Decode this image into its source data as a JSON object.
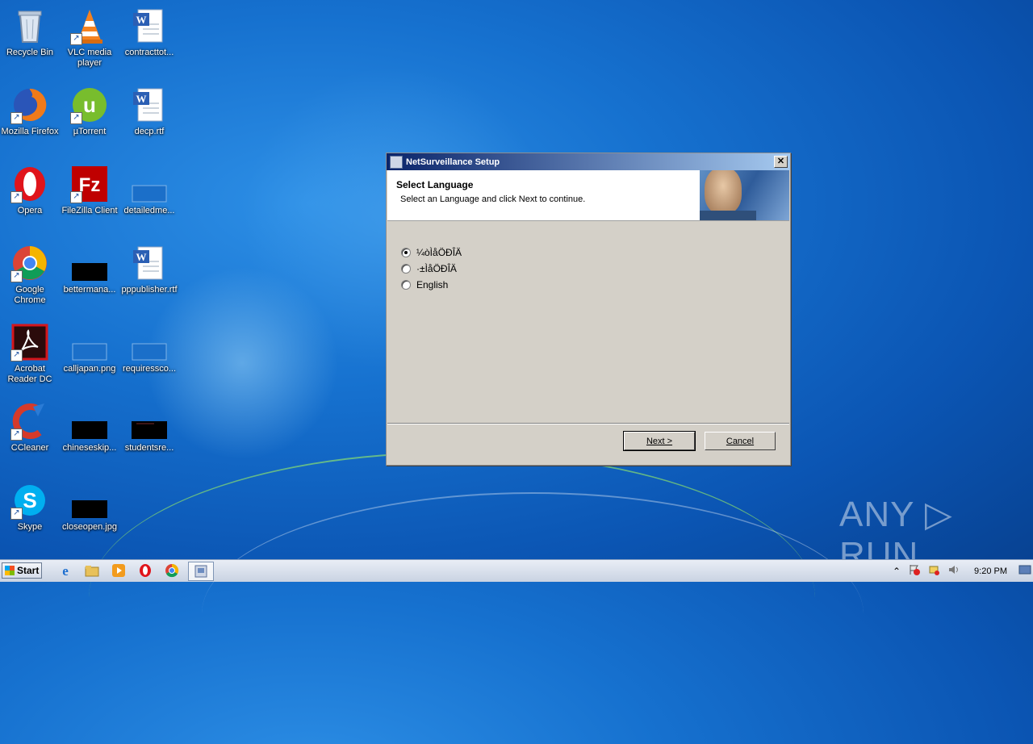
{
  "desktop": {
    "icons": [
      {
        "label": "Recycle Bin"
      },
      {
        "label": "VLC media player"
      },
      {
        "label": "contracttot..."
      },
      {
        "label": "Mozilla Firefox"
      },
      {
        "label": "µTorrent"
      },
      {
        "label": "decp.rtf"
      },
      {
        "label": "Opera"
      },
      {
        "label": "FileZilla Client"
      },
      {
        "label": "detailedme..."
      },
      {
        "label": "Google Chrome"
      },
      {
        "label": "bettermana..."
      },
      {
        "label": "pppublisher.rtf"
      },
      {
        "label": "Acrobat Reader DC"
      },
      {
        "label": "calljapan.png"
      },
      {
        "label": "requiressco..."
      },
      {
        "label": "CCleaner"
      },
      {
        "label": "chineseskip..."
      },
      {
        "label": "studentsre..."
      },
      {
        "label": "Skype"
      },
      {
        "label": "closeopen.jpg"
      }
    ]
  },
  "dialog": {
    "title": "NetSurveillance Setup",
    "close": "✕",
    "heading": "Select Language",
    "subheading": "Select an Language and click Next to continue.",
    "options": [
      {
        "label": "¼òÌåÖÐÎÄ",
        "selected": true
      },
      {
        "label": "·±ÌåÖÐÎÄ",
        "selected": false
      },
      {
        "label": "English",
        "selected": false
      }
    ],
    "next_label": "Next >",
    "cancel_label": "Cancel"
  },
  "taskbar": {
    "start_label": "Start",
    "clock": "9:20 PM",
    "tray_chevron": "⌃"
  },
  "watermark": "ANY ▷ RUN"
}
